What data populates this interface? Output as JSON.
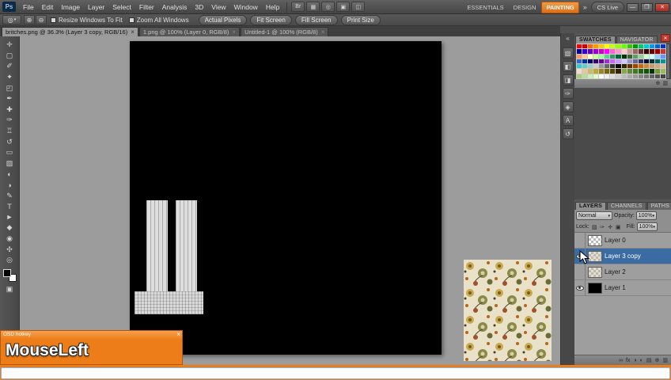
{
  "window": {
    "minimize": "—",
    "restore": "❐",
    "close": "✕"
  },
  "ui_glyphs": {
    "tab_close": "×",
    "dropdown": "▾",
    "collapse": "«"
  },
  "menu": {
    "logo": "Ps",
    "items": [
      "File",
      "Edit",
      "Image",
      "Layer",
      "Select",
      "Filter",
      "Analysis",
      "3D",
      "View",
      "Window",
      "Help"
    ],
    "appbar_icons": [
      {
        "name": "launch-bridge-icon",
        "glyph": "Br"
      },
      {
        "name": "view-extras-icon",
        "glyph": "▦"
      },
      {
        "name": "zoom-level-icon",
        "glyph": "◎"
      },
      {
        "name": "arrange-documents-icon",
        "glyph": "▣"
      },
      {
        "name": "screen-mode-icon",
        "glyph": "◫"
      }
    ],
    "workspaces": [
      {
        "label": "ESSENTIALS",
        "active": false
      },
      {
        "label": "DESIGN",
        "active": false
      },
      {
        "label": "PAINTING",
        "active": true
      }
    ],
    "overflow_icon": "»",
    "cs_live_label": "CS Live"
  },
  "options": {
    "tool_glyph": "◎",
    "zoom_in_glyph": "⊕",
    "zoom_out_glyph": "⊖",
    "checkboxes": [
      {
        "label": "Resize Windows To Fit",
        "checked": false
      },
      {
        "label": "Zoom All Windows",
        "checked": false
      }
    ],
    "buttons": [
      "Actual Pixels",
      "Fit Screen",
      "Fill Screen",
      "Print Size"
    ]
  },
  "tabs": [
    {
      "label": "britches.png @ 36.3% (Layer 3 copy, RGB/16)",
      "active": true
    },
    {
      "label": "1.png @ 100% (Layer 0, RGB/8)",
      "active": false
    },
    {
      "label": "Untitled-1 @ 100% (RGB/8)",
      "active": false
    }
  ],
  "tools": [
    {
      "name": "move-tool",
      "glyph": "✛"
    },
    {
      "name": "rectangular-marquee-tool",
      "glyph": "▢"
    },
    {
      "name": "lasso-tool",
      "glyph": "✐"
    },
    {
      "name": "quick-selection-tool",
      "glyph": "✦"
    },
    {
      "name": "crop-tool",
      "glyph": "◰"
    },
    {
      "name": "eyedropper-tool",
      "glyph": "✒"
    },
    {
      "name": "spot-healing-brush-tool",
      "glyph": "✚"
    },
    {
      "name": "brush-tool",
      "glyph": "✑"
    },
    {
      "name": "clone-stamp-tool",
      "glyph": "♖"
    },
    {
      "name": "history-brush-tool",
      "glyph": "↺"
    },
    {
      "name": "eraser-tool",
      "glyph": "▭"
    },
    {
      "name": "gradient-tool",
      "glyph": "▨"
    },
    {
      "name": "blur-tool",
      "glyph": "◐"
    },
    {
      "name": "dodge-tool",
      "glyph": "◑"
    },
    {
      "name": "pen-tool",
      "glyph": "✎"
    },
    {
      "name": "type-tool",
      "glyph": "T"
    },
    {
      "name": "path-selection-tool",
      "glyph": "►"
    },
    {
      "name": "rectangle-tool",
      "glyph": "◆"
    },
    {
      "name": "3d-rotate-tool",
      "glyph": "◉"
    },
    {
      "name": "hand-tool",
      "glyph": "✣"
    },
    {
      "name": "zoom-tool",
      "glyph": "◎"
    }
  ],
  "toolbox": {
    "foreground": "#000000",
    "background": "#ffffff",
    "extra_icons": [
      {
        "name": "quick-mask-icon",
        "glyph": "▣"
      }
    ]
  },
  "dock_icons": [
    {
      "name": "color-panel-icon",
      "glyph": "▧"
    },
    {
      "name": "adjustments-panel-icon",
      "glyph": "◧"
    },
    {
      "name": "masks-panel-icon",
      "glyph": "◨"
    },
    {
      "name": "brush-presets-panel-icon",
      "glyph": "✑"
    },
    {
      "name": "clone-source-panel-icon",
      "glyph": "◈"
    },
    {
      "name": "character-panel-icon",
      "glyph": "A"
    },
    {
      "name": "history-panel-icon",
      "glyph": "↺"
    }
  ],
  "swatches": {
    "tabs": [
      "SWATCHES",
      "NAVIGATOR"
    ],
    "close_glyph": "✕",
    "colors": [
      "#ff0000",
      "#cc0000",
      "#ff6600",
      "#ff9900",
      "#ffcc00",
      "#ffff00",
      "#ccff00",
      "#99ff00",
      "#66ff00",
      "#33cc00",
      "#009900",
      "#00cc66",
      "#00cccc",
      "#0099ff",
      "#0066cc",
      "#0033cc",
      "#000099",
      "#3300cc",
      "#6600cc",
      "#9900cc",
      "#cc00cc",
      "#ff00ff",
      "#ff66cc",
      "#ff99cc",
      "#ffcccc",
      "#cc9999",
      "#996666",
      "#663333",
      "#330000",
      "#660000",
      "#990000",
      "#cc3333",
      "#ff9966",
      "#ffcc99",
      "#ffffcc",
      "#ccff99",
      "#99ff99",
      "#66cc99",
      "#339966",
      "#006633",
      "#003300",
      "#336633",
      "#669966",
      "#99cc99",
      "#ccffcc",
      "#ccffff",
      "#99ccff",
      "#6699ff",
      "#3366cc",
      "#003399",
      "#000066",
      "#330066",
      "#660099",
      "#9933cc",
      "#cc66ff",
      "#cc99ff",
      "#ccccff",
      "#9999cc",
      "#666699",
      "#333366",
      "#000033",
      "#003333",
      "#006666",
      "#009999",
      "#33cccc",
      "#66cccc",
      "#99cccc",
      "#cccccc",
      "#999999",
      "#666666",
      "#333333",
      "#000000",
      "#332200",
      "#663300",
      "#994400",
      "#cc6600",
      "#cc8833",
      "#cc9966",
      "#ccaa88",
      "#ddbb99",
      "#eeddcc",
      "#ddcc99",
      "#ccbb66",
      "#bbaa33",
      "#998822",
      "#776611",
      "#554400",
      "#332200",
      "#88aa44",
      "#668833",
      "#447722",
      "#226611",
      "#115500",
      "#003300",
      "#779933",
      "#99bb55",
      "#aacc77",
      "#bbdd99",
      "#cceebb",
      "#ddffcc",
      "#ffffff",
      "#eeeeee",
      "#dddddd",
      "#cccccc",
      "#bbbbbb",
      "#aaaaaa",
      "#999999",
      "#888888",
      "#777777",
      "#666666",
      "#555555",
      "#444444"
    ],
    "footer_icons": [
      {
        "name": "new-swatch-icon",
        "glyph": "⊕"
      },
      {
        "name": "delete-swatch-icon",
        "glyph": "▥"
      }
    ]
  },
  "layers_panel": {
    "tabs": [
      "LAYERS",
      "CHANNELS",
      "PATHS"
    ],
    "blend_mode": "Normal",
    "opacity_label": "Opacity:",
    "opacity_value": "100%",
    "lock_label": "Lock:",
    "lock_icons": [
      {
        "name": "lock-transparency-icon",
        "glyph": "▨"
      },
      {
        "name": "lock-pixels-icon",
        "glyph": "✑"
      },
      {
        "name": "lock-position-icon",
        "glyph": "✛"
      },
      {
        "name": "lock-all-icon",
        "glyph": "▣"
      }
    ],
    "fill_label": "Fill:",
    "fill_value": "100%",
    "layers": [
      {
        "name": "Layer 0",
        "visible": false,
        "selected": false,
        "thumb": "checker"
      },
      {
        "name": "Layer 3 copy",
        "visible": true,
        "selected": true,
        "thumb": "pattern"
      },
      {
        "name": "Layer 2",
        "visible": false,
        "selected": false,
        "thumb": "pattern"
      },
      {
        "name": "Layer 1",
        "visible": true,
        "selected": false,
        "thumb": "black"
      }
    ],
    "footer_icons": [
      {
        "name": "link-layers-icon",
        "glyph": "∞"
      },
      {
        "name": "layer-styles-icon",
        "glyph": "fx"
      },
      {
        "name": "add-layer-mask-icon",
        "glyph": "◑"
      },
      {
        "name": "adjustment-layer-icon",
        "glyph": "◐"
      },
      {
        "name": "new-group-icon",
        "glyph": "▤"
      },
      {
        "name": "new-layer-icon",
        "glyph": "⊕"
      },
      {
        "name": "delete-layer-icon",
        "glyph": "▥"
      }
    ]
  },
  "osd": {
    "title": "OSD hotkey",
    "close_glyph": "×",
    "key_text": "MouseLeft"
  },
  "colors": {
    "workspace_active_bg": "#dd6f14",
    "selected_layer_bg": "#3a6ca3",
    "osd_bg": "#ed7d18",
    "canvas_bg": "#9c9c9c",
    "chrome_bg": "#525252"
  }
}
